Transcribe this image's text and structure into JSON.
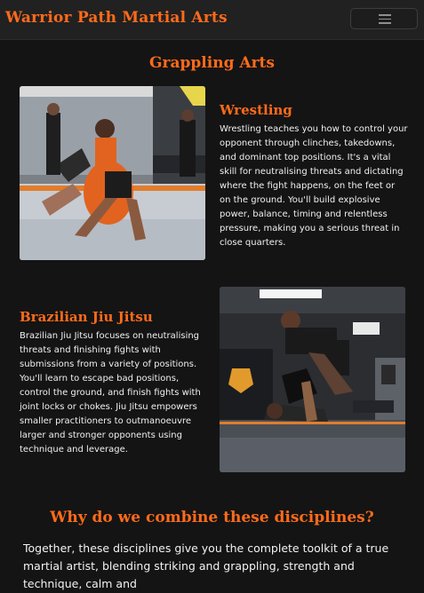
{
  "nav": {
    "brand": "Warrior Path Martial Arts",
    "toggle_icon": "hamburger-menu-icon"
  },
  "grappling": {
    "heading": "Grappling Arts",
    "wrestling": {
      "title": "Wrestling",
      "text": "Wrestling teaches you how to control your opponent through clinches, takedowns, and dominant top positions. It's a vital skill for neutralising threats and dictating where the fight happens, on the feet or on the ground. You'll build explosive power, balance, timing and relentless pressure, making you a serious threat in close quarters.",
      "image_description_icon": "wrestling-photo"
    },
    "bjj": {
      "title": "Brazilian Jiu Jitsu",
      "text": "Brazilian Jiu Jitsu focuses on neutralising threats and finishing fights with submissions from a variety of positions. You'll learn to escape bad positions, control the ground, and finish fights with joint locks or chokes. Jiu Jitsu empowers smaller practitioners to outmanoeuvre larger and stronger opponents using technique and leverage.",
      "image_description_icon": "bjj-photo"
    }
  },
  "combine": {
    "heading": "Why do we combine these disciplines?",
    "text": "Together, these disciplines give you the complete toolkit of a true martial artist, blending striking and grappling, strength and technique, calm and"
  },
  "colors": {
    "accent": "#ff6b1a",
    "background": "#141414",
    "navbar": "#212121"
  }
}
